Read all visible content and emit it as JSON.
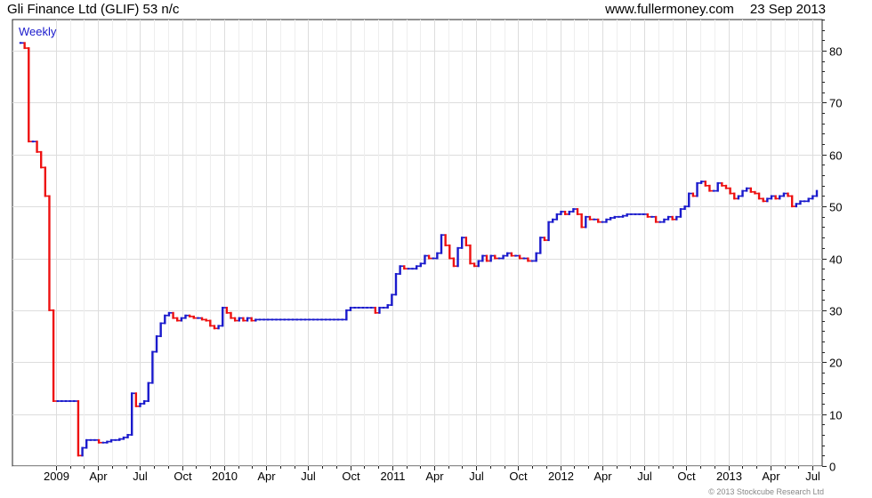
{
  "header": {
    "title": "Gli Finance Ltd (GLIF) 53 n/c",
    "site": "www.fullermoney.com",
    "date": "23 Sep 2013"
  },
  "footer": {
    "copyright": "© 2013 Stockcube Research Ltd"
  },
  "chart_data": {
    "type": "line",
    "period_label": "Weekly",
    "ylim": [
      0,
      86
    ],
    "yticks": [
      0,
      10,
      20,
      30,
      40,
      50,
      60,
      70,
      80
    ],
    "xticks": [
      "2009",
      "Apr",
      "Jul",
      "Oct",
      "2010",
      "Apr",
      "Jul",
      "Oct",
      "2011",
      "Apr",
      "Jul",
      "Oct",
      "2012",
      "Apr",
      "Jul",
      "Oct",
      "2013",
      "Apr",
      "Jul"
    ],
    "grid": true,
    "up_color": "#1a1acc",
    "down_color": "#ee1111",
    "series": [
      {
        "values": [
          81.5,
          80.5,
          62.5,
          62.5,
          60.5,
          57.5,
          52.0,
          30.0,
          12.5,
          12.5,
          12.5,
          12.5,
          12.5,
          12.5,
          2.0,
          3.5,
          5.0,
          5.0,
          5.0,
          4.5,
          4.5,
          4.7,
          5.0,
          5.0,
          5.2,
          5.5,
          6.0,
          14.0,
          11.5,
          12.0,
          12.5,
          16.0,
          22.0,
          25.0,
          27.5,
          29.0,
          29.5,
          28.5,
          28.0,
          28.5,
          29.0,
          28.8,
          28.5,
          28.5,
          28.2,
          28.0,
          27.0,
          26.5,
          27.0,
          30.5,
          29.5,
          28.5,
          28.0,
          28.5,
          28.0,
          28.5,
          28.0,
          28.2,
          28.2,
          28.2,
          28.2,
          28.2,
          28.2,
          28.2,
          28.2,
          28.2,
          28.2,
          28.2,
          28.2,
          28.2,
          28.2,
          28.2,
          28.2,
          28.2,
          28.2,
          28.2,
          28.2,
          28.2,
          28.2,
          30.0,
          30.5,
          30.5,
          30.5,
          30.5,
          30.5,
          30.5,
          29.5,
          30.5,
          30.5,
          31.0,
          33.0,
          37.0,
          38.5,
          38.0,
          38.0,
          38.0,
          38.5,
          39.0,
          40.5,
          40.0,
          40.0,
          41.0,
          44.5,
          42.5,
          40.0,
          38.5,
          42.0,
          44.0,
          42.5,
          39.0,
          38.5,
          39.5,
          40.5,
          39.5,
          40.5,
          40.0,
          40.0,
          40.5,
          41.0,
          40.5,
          40.5,
          40.0,
          40.0,
          39.5,
          39.5,
          41.0,
          44.0,
          43.5,
          47.0,
          47.5,
          48.5,
          49.0,
          48.5,
          49.0,
          49.5,
          48.5,
          46.0,
          48.0,
          47.5,
          47.5,
          47.0,
          47.0,
          47.5,
          47.8,
          48.0,
          48.0,
          48.2,
          48.5,
          48.5,
          48.5,
          48.5,
          48.5,
          48.0,
          48.0,
          47.0,
          47.0,
          47.5,
          48.0,
          47.5,
          48.0,
          49.5,
          50.0,
          52.5,
          52.0,
          54.5,
          54.8,
          54.0,
          53.0,
          53.0,
          54.5,
          54.0,
          53.5,
          52.5,
          51.5,
          52.0,
          53.0,
          53.5,
          52.8,
          52.5,
          51.5,
          51.0,
          51.5,
          52.0,
          51.5,
          52.0,
          52.5,
          52.0,
          50.0,
          50.5,
          51.0,
          51.0,
          51.5,
          52.0,
          53.0
        ]
      }
    ]
  }
}
